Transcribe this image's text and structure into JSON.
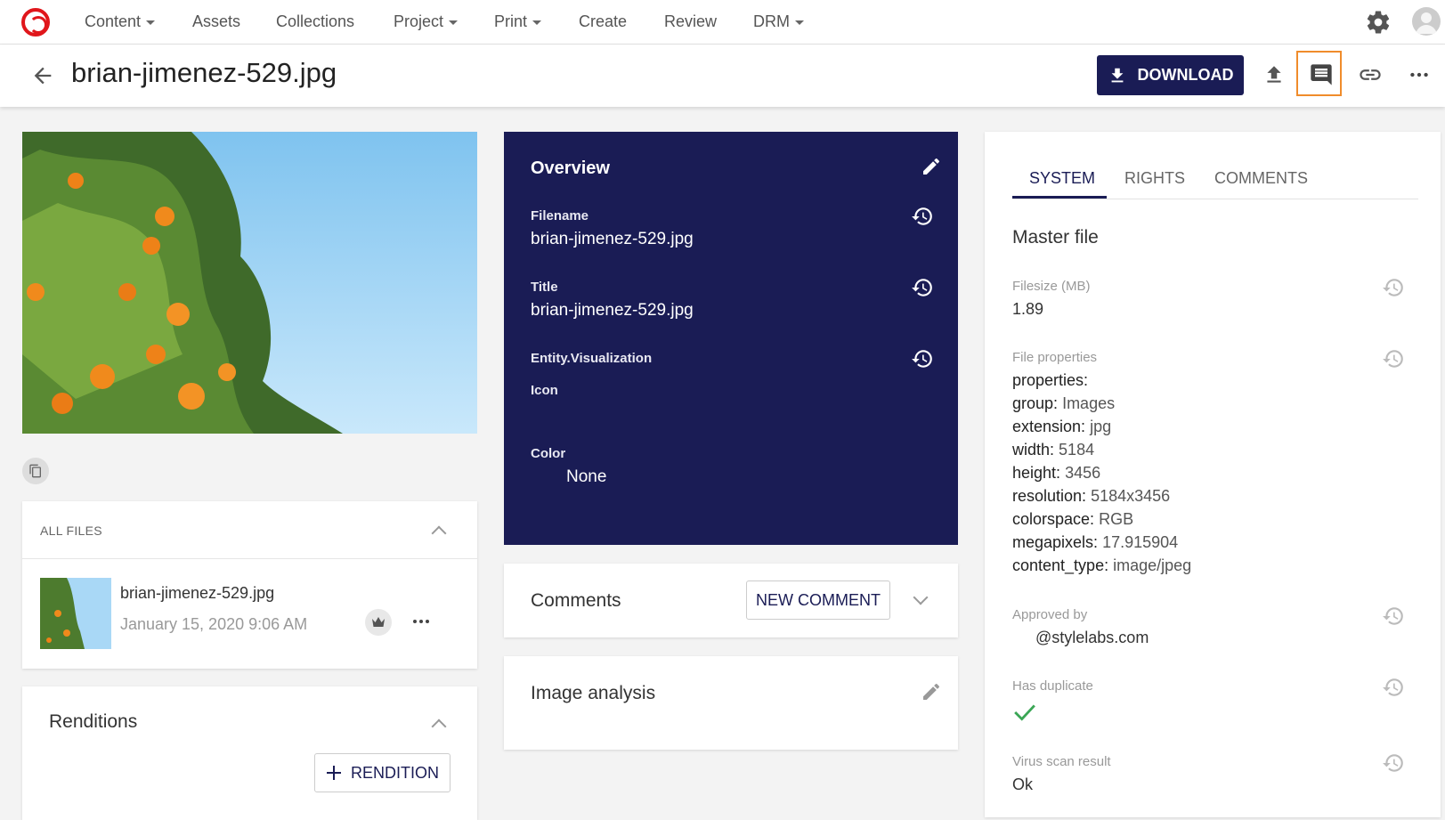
{
  "nav": {
    "items": [
      {
        "label": "Content",
        "dropdown": true
      },
      {
        "label": "Assets",
        "dropdown": false
      },
      {
        "label": "Collections",
        "dropdown": false
      },
      {
        "label": "Project",
        "dropdown": true
      },
      {
        "label": "Print",
        "dropdown": true
      },
      {
        "label": "Create",
        "dropdown": false
      },
      {
        "label": "Review",
        "dropdown": false
      },
      {
        "label": "DRM",
        "dropdown": true
      }
    ]
  },
  "header": {
    "title": "brian-jimenez-529.jpg",
    "download_label": "DOWNLOAD"
  },
  "files": {
    "heading": "ALL FILES",
    "items": [
      {
        "name": "brian-jimenez-529.jpg",
        "date": "January 15, 2020 9:06 AM"
      }
    ]
  },
  "renditions": {
    "heading": "Renditions",
    "add_label": "RENDITION"
  },
  "overview": {
    "title": "Overview",
    "filename_label": "Filename",
    "filename_value": "brian-jimenez-529.jpg",
    "title_label": "Title",
    "title_value": "brian-jimenez-529.jpg",
    "viz_label": "Entity.Visualization",
    "icon_label": "Icon",
    "color_label": "Color",
    "color_value": "None"
  },
  "comments": {
    "heading": "Comments",
    "new_label": "NEW COMMENT"
  },
  "image_analysis": {
    "heading": "Image analysis"
  },
  "right_panel": {
    "tabs": [
      "SYSTEM",
      "RIGHTS",
      "COMMENTS"
    ],
    "active_tab": "SYSTEM",
    "heading": "Master file",
    "filesize_label": "Filesize (MB)",
    "filesize_value": "1.89",
    "fileprops_label": "File properties",
    "properties": [
      {
        "key": "properties:",
        "value": ""
      },
      {
        "key": "group:",
        "value": "Images"
      },
      {
        "key": "extension:",
        "value": "jpg"
      },
      {
        "key": "width:",
        "value": "5184"
      },
      {
        "key": "height:",
        "value": "3456"
      },
      {
        "key": "resolution:",
        "value": "5184x3456"
      },
      {
        "key": "colorspace:",
        "value": "RGB"
      },
      {
        "key": "megapixels:",
        "value": "17.915904"
      },
      {
        "key": "content_type:",
        "value": "image/jpeg"
      }
    ],
    "approved_label": "Approved by",
    "approved_value": "@stylelabs.com",
    "duplicate_label": "Has duplicate",
    "virus_label": "Virus scan result",
    "virus_value": "Ok"
  },
  "colors": {
    "brand": "#1a1c55",
    "logo": "#e0161b",
    "highlight": "#f08c2b",
    "check": "#3aa655"
  }
}
